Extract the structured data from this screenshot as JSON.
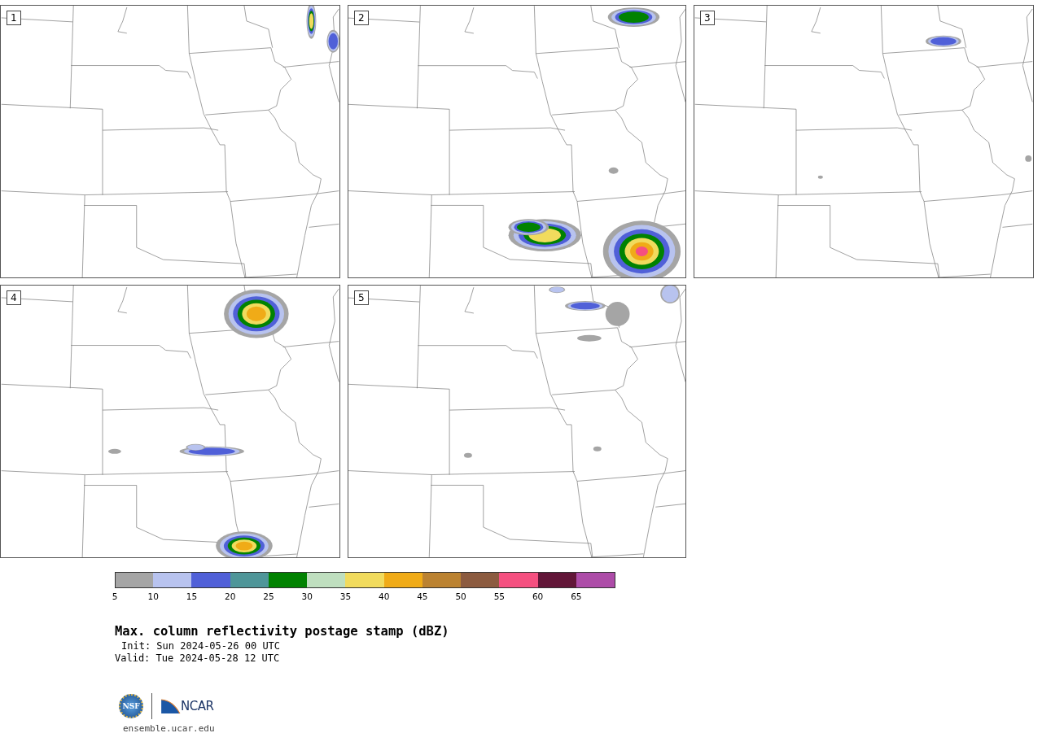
{
  "panels": [
    {
      "label": "1"
    },
    {
      "label": "2"
    },
    {
      "label": "3"
    },
    {
      "label": "4"
    },
    {
      "label": "5"
    }
  ],
  "colorbar": [
    {
      "color": "#a5a5a5",
      "tick": "5"
    },
    {
      "color": "#b8c3ef",
      "tick": "10"
    },
    {
      "color": "#5060d8",
      "tick": "15"
    },
    {
      "color": "#4f9699",
      "tick": "20"
    },
    {
      "color": "#018201",
      "tick": "25"
    },
    {
      "color": "#bfdfbf",
      "tick": "30"
    },
    {
      "color": "#f1db5d",
      "tick": "35"
    },
    {
      "color": "#f0ab17",
      "tick": "40"
    },
    {
      "color": "#bb8231",
      "tick": "45"
    },
    {
      "color": "#8c5b40",
      "tick": "50"
    },
    {
      "color": "#f55080",
      "tick": "55"
    },
    {
      "color": "#621638",
      "tick": "60"
    },
    {
      "color": "#ad4ca8",
      "tick": "65"
    }
  ],
  "title": "Max. column reflectivity postage stamp (dBZ)",
  "init": "Init: Sun 2024-05-26 00 UTC",
  "valid": "Valid: Tue 2024-05-28 12 UTC",
  "logos": [
    {
      "kind": "nsf",
      "text": "NSF"
    },
    {
      "kind": "ncar",
      "text": "NCAR"
    }
  ],
  "url": "ensemble.ucar.edu"
}
